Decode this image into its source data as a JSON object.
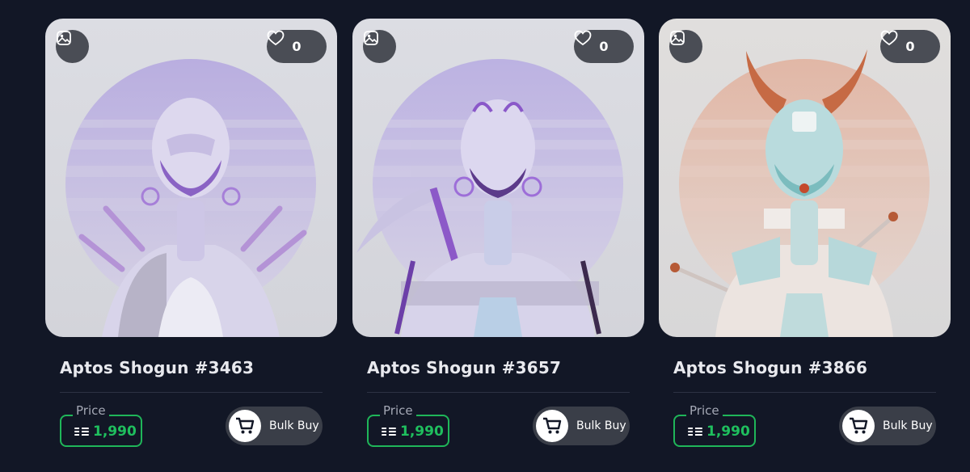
{
  "cards": [
    {
      "title": "Aptos Shogun #3463",
      "likes": "0",
      "price_label": "Price",
      "price": "1,990",
      "bulk_label": "Bulk Buy",
      "palette": "lavender"
    },
    {
      "title": "Aptos Shogun #3657",
      "likes": "0",
      "price_label": "Price",
      "price": "1,990",
      "bulk_label": "Bulk Buy",
      "palette": "lavender"
    },
    {
      "title": "Aptos Shogun #3866",
      "likes": "0",
      "price_label": "Price",
      "price": "1,990",
      "bulk_label": "Bulk Buy",
      "palette": "peach-teal"
    }
  ],
  "icons": {
    "image": "image-icon",
    "like": "heart-icon",
    "currency": "aptos-currency-icon",
    "bulk": "cart-icon"
  },
  "colors": {
    "background": "#121726",
    "price_accent": "#1fbf5e",
    "button_dark": "#4a4d55"
  }
}
